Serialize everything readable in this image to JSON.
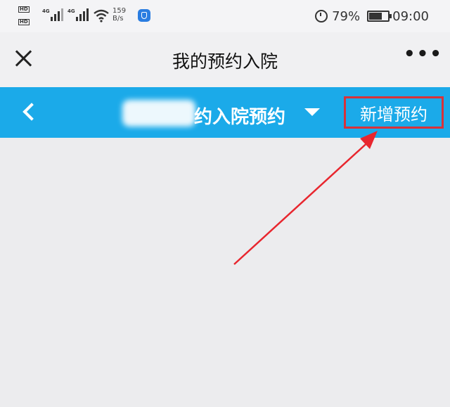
{
  "status_bar": {
    "sim1": "HD",
    "sim2": "HD",
    "net_type_1": "4G",
    "net_type_2": "4G",
    "net_speed_value": "159",
    "net_speed_unit": "B/s",
    "battery_level": "79%",
    "time": "09:00"
  },
  "title_bar": {
    "title": "我的预约入院",
    "more": "•••"
  },
  "nav_bar": {
    "title": "约入院预约",
    "add_button": "新增预约",
    "accent_color": "#1baae9",
    "highlight_color": "#d8323a"
  },
  "annotation": {
    "arrow_color": "#e8262e"
  }
}
